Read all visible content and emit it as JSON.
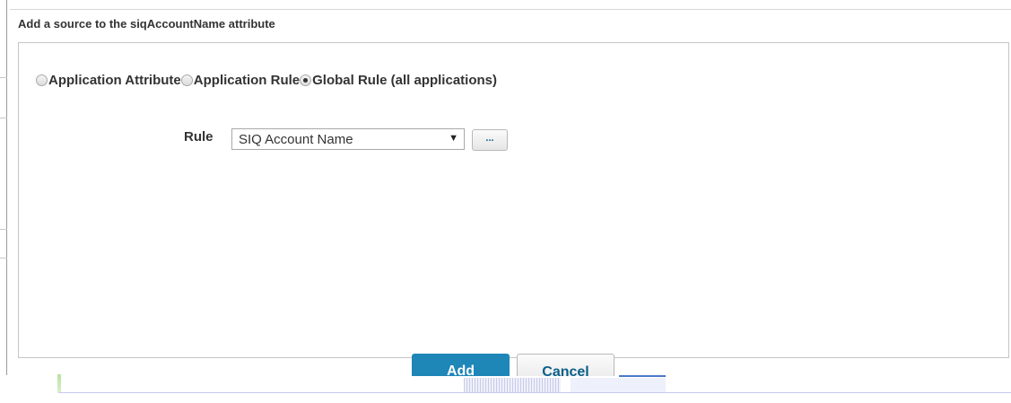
{
  "dialog": {
    "title": "Add a source to the siqAccountName attribute"
  },
  "source_options": [
    {
      "label": "Application Attribute",
      "checked": false
    },
    {
      "label": "Application Rule",
      "checked": false
    },
    {
      "label": "Global Rule (all applications)",
      "checked": true
    }
  ],
  "rule": {
    "label": "Rule",
    "selected": "SIQ Account Name",
    "arrow": "▼",
    "browse_label": "..."
  },
  "buttons": {
    "add_label": "Add",
    "cancel_label": "Cancel"
  },
  "colors": {
    "primary_button": "#1f86b8",
    "link_text": "#0b5f8a"
  }
}
